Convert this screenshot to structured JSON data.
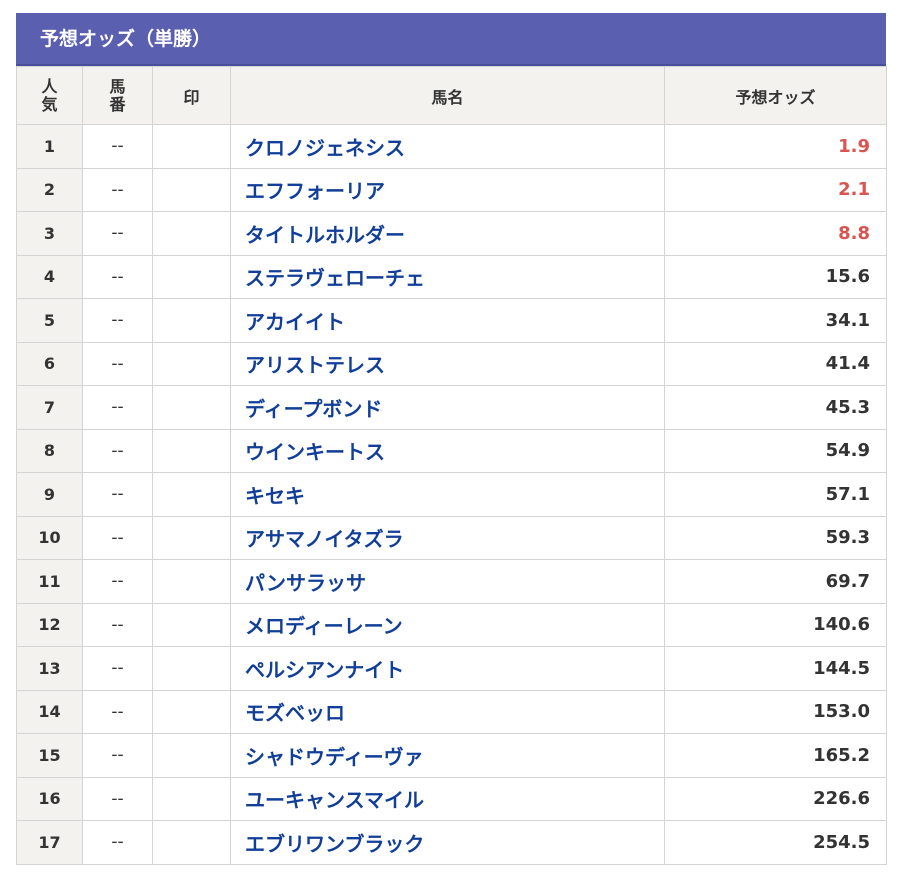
{
  "title": "予想オッズ（単勝）",
  "headers": {
    "popularity": "人\n気",
    "number": "馬\n番",
    "mark": "印",
    "horse_name": "馬名",
    "odds": "予想オッズ"
  },
  "colors": {
    "title_bg": "#5a5fb0",
    "name": "#103e98",
    "favorite_odds": "#d9534f"
  },
  "rows": [
    {
      "rank": "1",
      "num": "--",
      "mark": "",
      "name": "クロノジェネシス",
      "odds": "1.9",
      "fav": true
    },
    {
      "rank": "2",
      "num": "--",
      "mark": "",
      "name": "エフフォーリア",
      "odds": "2.1",
      "fav": true
    },
    {
      "rank": "3",
      "num": "--",
      "mark": "",
      "name": "タイトルホルダー",
      "odds": "8.8",
      "fav": true
    },
    {
      "rank": "4",
      "num": "--",
      "mark": "",
      "name": "ステラヴェローチェ",
      "odds": "15.6",
      "fav": false
    },
    {
      "rank": "5",
      "num": "--",
      "mark": "",
      "name": "アカイイト",
      "odds": "34.1",
      "fav": false
    },
    {
      "rank": "6",
      "num": "--",
      "mark": "",
      "name": "アリストテレス",
      "odds": "41.4",
      "fav": false
    },
    {
      "rank": "7",
      "num": "--",
      "mark": "",
      "name": "ディープボンド",
      "odds": "45.3",
      "fav": false
    },
    {
      "rank": "8",
      "num": "--",
      "mark": "",
      "name": "ウインキートス",
      "odds": "54.9",
      "fav": false
    },
    {
      "rank": "9",
      "num": "--",
      "mark": "",
      "name": "キセキ",
      "odds": "57.1",
      "fav": false
    },
    {
      "rank": "10",
      "num": "--",
      "mark": "",
      "name": "アサマノイタズラ",
      "odds": "59.3",
      "fav": false
    },
    {
      "rank": "11",
      "num": "--",
      "mark": "",
      "name": "パンサラッサ",
      "odds": "69.7",
      "fav": false
    },
    {
      "rank": "12",
      "num": "--",
      "mark": "",
      "name": "メロディーレーン",
      "odds": "140.6",
      "fav": false
    },
    {
      "rank": "13",
      "num": "--",
      "mark": "",
      "name": "ペルシアンナイト",
      "odds": "144.5",
      "fav": false
    },
    {
      "rank": "14",
      "num": "--",
      "mark": "",
      "name": "モズベッロ",
      "odds": "153.0",
      "fav": false
    },
    {
      "rank": "15",
      "num": "--",
      "mark": "",
      "name": "シャドウディーヴァ",
      "odds": "165.2",
      "fav": false
    },
    {
      "rank": "16",
      "num": "--",
      "mark": "",
      "name": "ユーキャンスマイル",
      "odds": "226.6",
      "fav": false
    },
    {
      "rank": "17",
      "num": "--",
      "mark": "",
      "name": "エブリワンブラック",
      "odds": "254.5",
      "fav": false
    }
  ]
}
